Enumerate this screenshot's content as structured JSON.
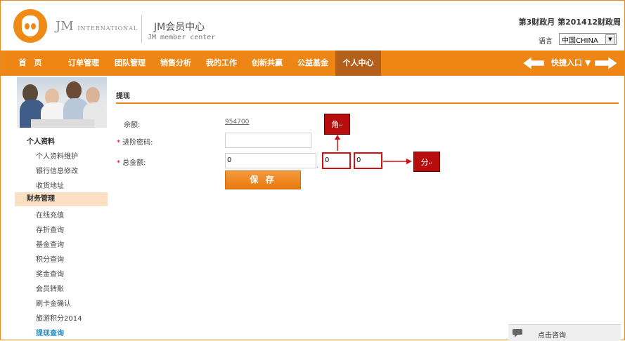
{
  "header": {
    "brand_initials": "JM",
    "brand_suffix": "INTERNATIONAL",
    "center_title": "JM会员中心",
    "center_subtitle": "JM member center",
    "fiscal_period": "第3财政月 第201412财政周",
    "language_label": "语言",
    "language_value": "中国CHINA"
  },
  "nav": {
    "items": [
      "首　页",
      "订单管理",
      "团队管理",
      "销售分析",
      "我的工作",
      "创新共赢",
      "公益基金",
      "个人中心"
    ],
    "quick_entry": "快捷入口"
  },
  "sidebar": {
    "section1": "个人资料",
    "section1_items": [
      "个人资料维护",
      "银行信息修改",
      "收货地址"
    ],
    "section2": "财务管理",
    "section2_items": [
      "在线充值",
      "存折查询",
      "基金查询",
      "积分查询",
      "奖金查询",
      "会员转账",
      "刷卡金确认",
      "旅游积分2014",
      "提现查询"
    ]
  },
  "form": {
    "title": "提现",
    "balance_label": "余额:",
    "balance_value": "954700",
    "password_label": "进阶密码:",
    "total_label": "总金额:",
    "amount_yuan": "0",
    "amount_jiao": "0",
    "amount_fen": "0",
    "save_label": "保 存",
    "required_mark": "*"
  },
  "annotations": {
    "jiao": "角",
    "fen": "分",
    "return_mark": "↵"
  },
  "help": {
    "label": "点击咨询"
  },
  "colors": {
    "accent": "#ee8615",
    "nav_active": "#b3601b",
    "callout": "#b80d0d",
    "link_active": "#1e8fd1"
  }
}
